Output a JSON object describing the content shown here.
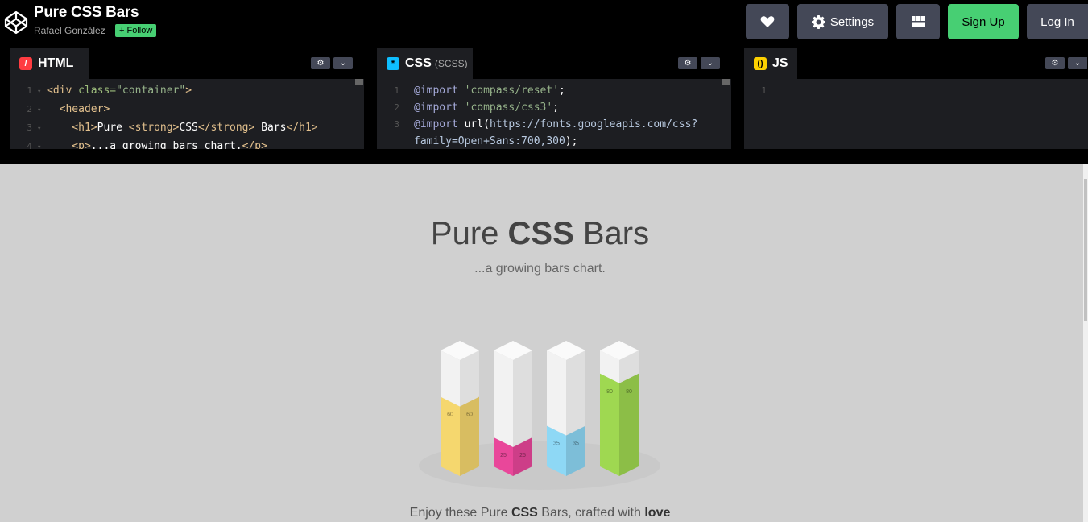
{
  "header": {
    "title": "Pure CSS Bars",
    "author": "Rafael González",
    "follow_label": "+ Follow",
    "settings_label": "Settings",
    "signup_label": "Sign Up",
    "login_label": "Log In"
  },
  "editors": {
    "html": {
      "label": "HTML",
      "lines": [
        {
          "n": "1",
          "parts": [
            [
              "c-tag",
              "<div "
            ],
            [
              "c-attr",
              "class="
            ],
            [
              "c-str",
              "\"container\""
            ],
            [
              "c-tag",
              ">"
            ]
          ]
        },
        {
          "n": "2",
          "parts": [
            [
              "c-tag",
              "  <header>"
            ]
          ]
        },
        {
          "n": "3",
          "parts": [
            [
              "c-tag",
              "    <h1>"
            ],
            [
              "c-txt",
              "Pure "
            ],
            [
              "c-tag",
              "<strong>"
            ],
            [
              "c-txt",
              "CSS"
            ],
            [
              "c-tag",
              "</strong>"
            ],
            [
              "c-txt",
              " Bars"
            ],
            [
              "c-tag",
              "</h1>"
            ]
          ]
        },
        {
          "n": "4",
          "parts": [
            [
              "c-tag",
              "    <p>"
            ],
            [
              "c-txt",
              "...a growing bars chart."
            ],
            [
              "c-tag",
              "</p>"
            ]
          ]
        }
      ]
    },
    "css": {
      "label": "CSS",
      "sublabel": "(SCSS)",
      "lines": [
        {
          "n": "1",
          "parts": [
            [
              "c-kw",
              "@import "
            ],
            [
              "c-str",
              "'compass/reset'"
            ],
            [
              "c-txt",
              ";"
            ]
          ]
        },
        {
          "n": "2",
          "parts": [
            [
              "c-kw",
              "@import "
            ],
            [
              "c-str",
              "'compass/css3'"
            ],
            [
              "c-txt",
              ";"
            ]
          ]
        },
        {
          "n": "3",
          "parts": [
            [
              "c-kw",
              "@import "
            ],
            [
              "c-txt",
              "url("
            ],
            [
              "c-url",
              "https://fonts.googleapis.com/css?"
            ]
          ]
        },
        {
          "n": "",
          "parts": [
            [
              "c-url",
              "family=Open+Sans:700,300"
            ],
            [
              "c-txt",
              ");"
            ]
          ]
        }
      ]
    },
    "js": {
      "label": "JS",
      "lines": [
        {
          "n": "1",
          "parts": []
        }
      ]
    }
  },
  "preview": {
    "title_pre": "Pure ",
    "title_bold": "CSS",
    "title_post": " Bars",
    "tagline": "...a growing bars chart.",
    "footer_pre": "Enjoy these Pure ",
    "footer_bold": "CSS",
    "footer_mid": " Bars, crafted with ",
    "footer_love": "love"
  },
  "chart_data": {
    "type": "bar",
    "categories": [
      "",
      "",
      "",
      ""
    ],
    "values": [
      60,
      25,
      35,
      80
    ],
    "labels": [
      "60",
      "25",
      "35",
      "80"
    ],
    "colors": [
      "#f5d76e",
      "#e9479a",
      "#8ed8f5",
      "#9fd851"
    ],
    "ylim": [
      0,
      100
    ]
  },
  "colors": {
    "accent_green": "#47cf73",
    "button_gray": "#444857",
    "html_badge": "#ff3c41",
    "css_badge": "#0ebeff",
    "js_badge": "#fcd000"
  }
}
